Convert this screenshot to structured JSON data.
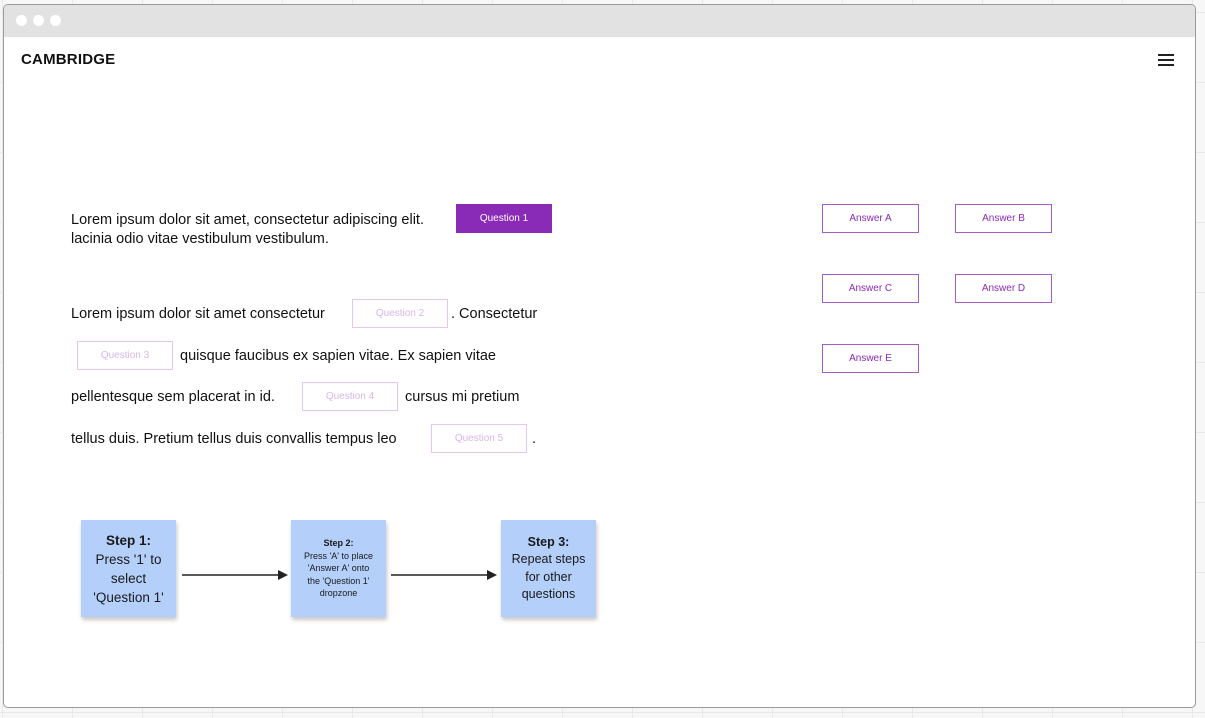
{
  "app": {
    "brand": "CAMBRIDGE"
  },
  "passage": {
    "line1": "Lorem ipsum dolor sit amet, consectetur adipiscing elit.",
    "line2": "lacinia odio vitae vestibulum vestibulum.",
    "line3a": "Lorem ipsum dolor sit amet consectetur",
    "line3b": ". Consectetur",
    "line4": "quisque faucibus ex sapien vitae. Ex sapien vitae",
    "line5a": "pellentesque sem placerat in id.",
    "line5b": "cursus mi pretium",
    "line6a": "tellus duis. Pretium tellus duis convallis tempus leo",
    "line6b": "."
  },
  "questions": [
    {
      "label": "Question 1",
      "state": "selected"
    },
    {
      "label": "Question 2",
      "state": "empty"
    },
    {
      "label": "Question 3",
      "state": "empty"
    },
    {
      "label": "Question 4",
      "state": "empty"
    },
    {
      "label": "Question 5",
      "state": "empty"
    }
  ],
  "answers": [
    {
      "label": "Answer A"
    },
    {
      "label": "Answer B"
    },
    {
      "label": "Answer C"
    },
    {
      "label": "Answer D"
    },
    {
      "label": "Answer E"
    }
  ],
  "steps": [
    {
      "title": "Step 1:",
      "body": [
        "Press '1' to",
        "select",
        "'Question 1'"
      ]
    },
    {
      "title": "Step 2:",
      "body": [
        "Press 'A' to place",
        "'Answer A' onto",
        "the 'Question 1'",
        "dropzone"
      ]
    },
    {
      "title": "Step 3:",
      "body": [
        "Repeat steps",
        "for other",
        "questions"
      ]
    }
  ],
  "colors": {
    "accent": "#8a2bb8",
    "note": "#b3cffa",
    "dropzone_border": "#e7c7ef"
  }
}
